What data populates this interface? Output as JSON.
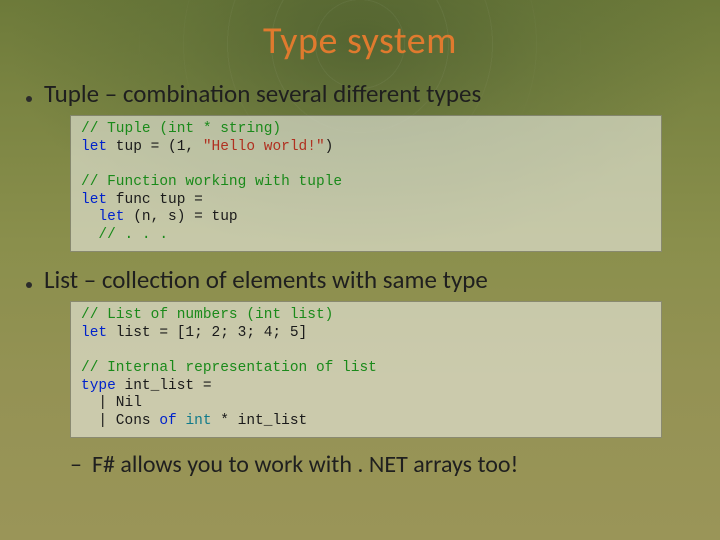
{
  "title": "Type system",
  "bullets": [
    {
      "text": "Tuple – combination several different types"
    },
    {
      "text": "List – collection of elements with same type"
    }
  ],
  "sub_bullet": "F# allows you to work with . NET arrays too!",
  "code1": {
    "l1": "// Tuple (int * string)",
    "l2_kw": "let",
    "l2_rest": " tup = (1, ",
    "l2_str": "\"Hello world!\"",
    "l2_end": ")",
    "blank": "",
    "l3": "// Function working with tuple",
    "l4_kw": "let",
    "l4_rest": " func tup =",
    "l5_kw": "  let",
    "l5_rest": " (n, s) = tup",
    "l6": "  // . . ."
  },
  "code2": {
    "l1": "// List of numbers (int list)",
    "l2_kw": "let",
    "l2_rest": " list = [1; 2; 3; 4; 5]",
    "blank": "",
    "l3": "// Internal representation of list",
    "l4_kw": "type",
    "l4_rest": " int_list =",
    "l5": "  | Nil",
    "l6a": "  | Cons ",
    "l6_kw": "of",
    "l6b": " ",
    "l6_t1": "int",
    "l6c": " * int_list"
  }
}
